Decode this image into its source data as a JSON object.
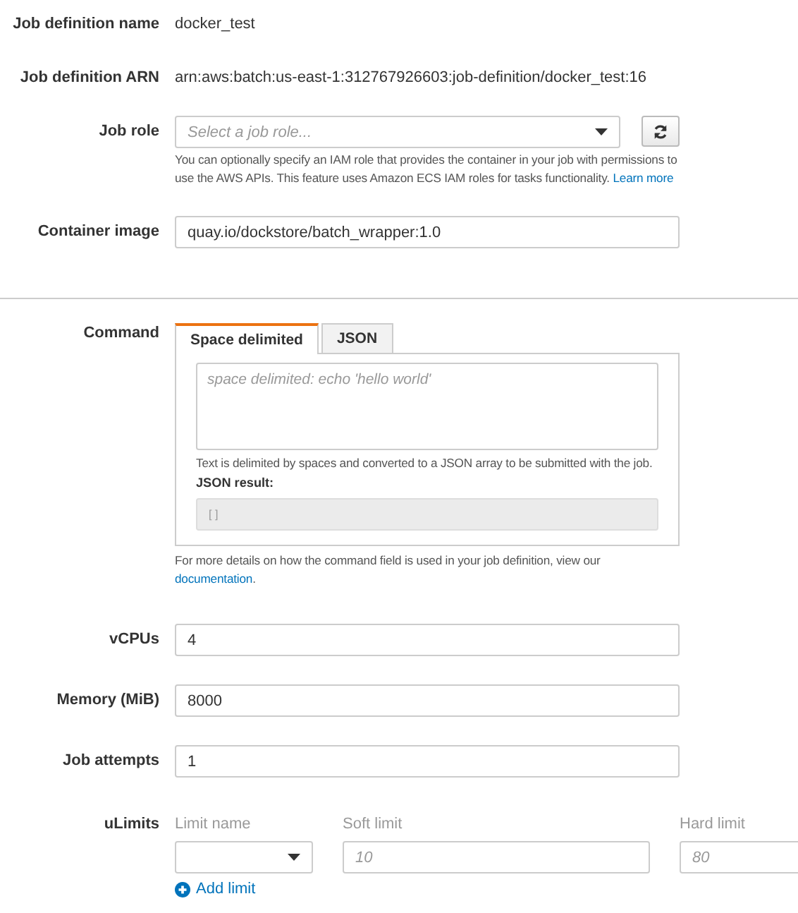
{
  "fields": [
    {
      "kind": "text",
      "label": "Job definition name",
      "value": "docker_test"
    },
    {
      "kind": "text",
      "label": "Job definition ARN",
      "value": "arn:aws:batch:us-east-1:312767926603:job-definition/docker_test:16"
    },
    {
      "kind": "select",
      "label": "Job role",
      "placeholder": "Select a job role...",
      "help": "You can optionally specify an IAM role that provides the container in your job with permissions to use the AWS APIs. This feature uses Amazon ECS IAM roles for tasks functionality.",
      "help_link": "Learn more"
    },
    {
      "kind": "input",
      "label": "Container image",
      "value": "quay.io/dockstore/batch_wrapper:1.0"
    }
  ],
  "command": {
    "label": "Command",
    "tabs": [
      {
        "label": "Space delimited",
        "selected": true
      },
      {
        "label": "JSON",
        "selected": false
      }
    ],
    "placeholder": "space delimited: echo 'hello world'",
    "help": "Text is delimited by spaces and converted to a JSON array to be submitted with the job.",
    "result_label": "JSON result:",
    "result": "[ ]",
    "footer": "For more details on how the command field is used in your job definition, view our",
    "footer_link": "documentation",
    "footer_end": "."
  },
  "resources": [
    {
      "label": "vCPUs",
      "value": "4"
    },
    {
      "label": "Memory (MiB)",
      "value": "8000"
    },
    {
      "label": "Job attempts",
      "value": "1"
    }
  ],
  "ulimits": {
    "label": "uLimits",
    "columns": [
      "Limit name",
      "Soft limit",
      "Hard limit"
    ],
    "soft_placeholder": "10",
    "hard_placeholder": "80",
    "add_label": "Add limit"
  }
}
